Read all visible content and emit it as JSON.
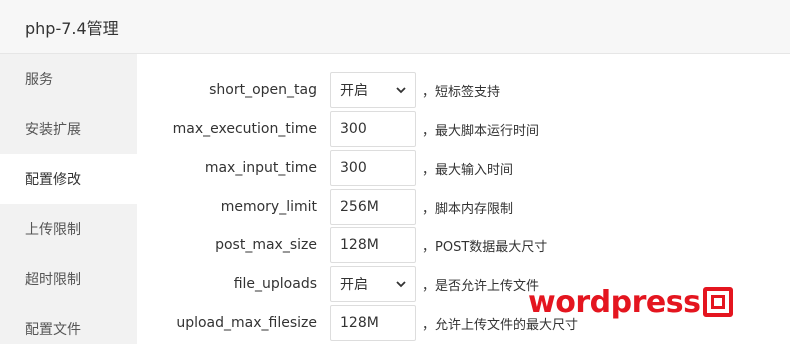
{
  "header": {
    "title": "php-7.4管理"
  },
  "sidebar": {
    "items": [
      {
        "label": "服务"
      },
      {
        "label": "安装扩展"
      },
      {
        "label": "配置修改",
        "active": true
      },
      {
        "label": "上传限制"
      },
      {
        "label": "超时限制"
      },
      {
        "label": "配置文件"
      }
    ]
  },
  "settings": [
    {
      "name": "short_open_tag",
      "type": "select",
      "value": "开启",
      "desc": "，短标签支持"
    },
    {
      "name": "max_execution_time",
      "type": "input",
      "value": "300",
      "desc": "，最大脚本运行时间"
    },
    {
      "name": "max_input_time",
      "type": "input",
      "value": "300",
      "desc": "，最大输入时间"
    },
    {
      "name": "memory_limit",
      "type": "input",
      "value": "256M",
      "desc": "，脚本内存限制"
    },
    {
      "name": "post_max_size",
      "type": "input",
      "value": "128M",
      "desc": "，POST数据最大尺寸"
    },
    {
      "name": "file_uploads",
      "type": "select",
      "value": "开启",
      "desc": "，是否允许上传文件"
    },
    {
      "name": "upload_max_filesize",
      "type": "input",
      "value": "128M",
      "desc": "，允许上传文件的最大尺寸"
    }
  ],
  "watermark": {
    "text": "wordpress",
    "seal_icon": "seal-icon",
    "color": "#e4151f"
  },
  "colors": {
    "sidebar_bg": "#f2f2f2",
    "header_bg": "#f7f7f7",
    "border": "#dddddd"
  }
}
